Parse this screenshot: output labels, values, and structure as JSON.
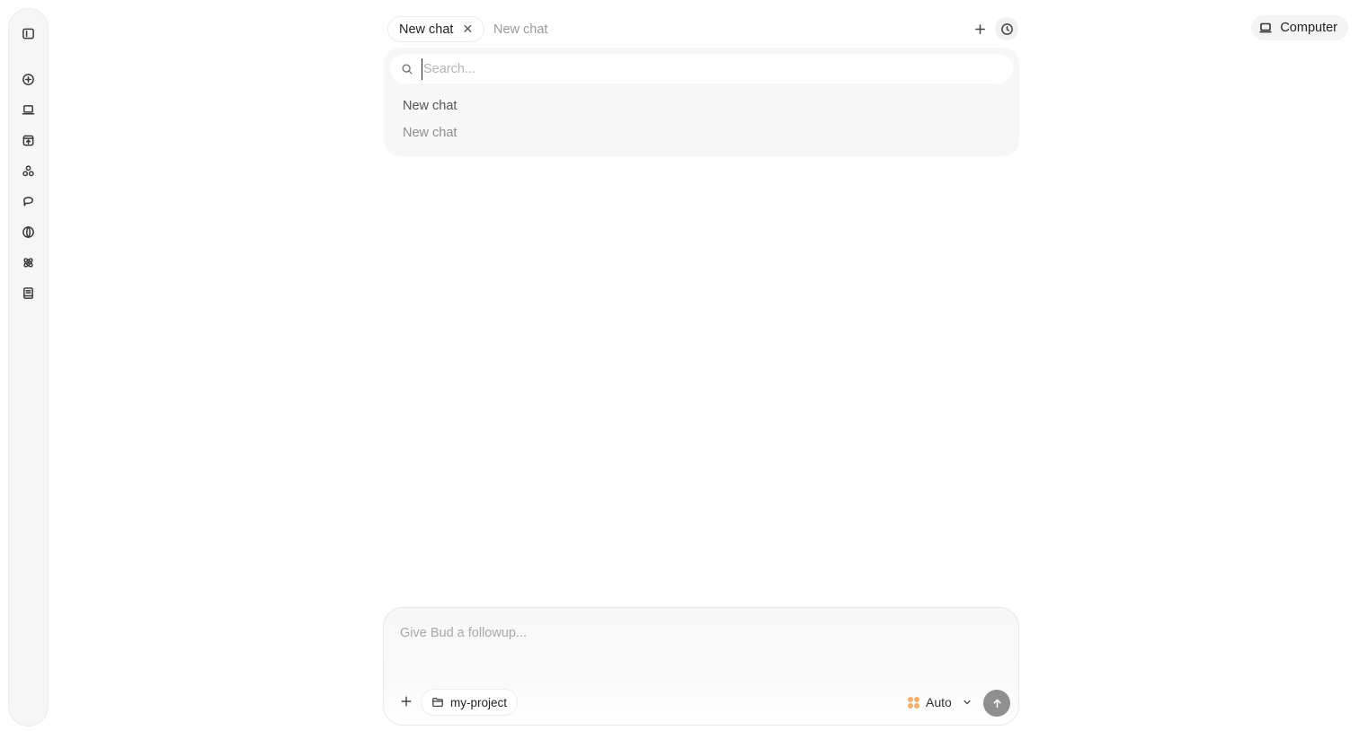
{
  "sidebar": {
    "items": [
      {
        "icon": "sidebar-toggle-icon"
      },
      {
        "icon": "new-chat-plus-circle-icon"
      },
      {
        "icon": "laptop-icon"
      },
      {
        "icon": "inbox-archive-icon"
      },
      {
        "icon": "shapes-icon"
      },
      {
        "icon": "chat-bubble-icon"
      },
      {
        "icon": "globe-icon"
      },
      {
        "icon": "atom-icon"
      },
      {
        "icon": "notebook-icon"
      }
    ]
  },
  "tabs": [
    {
      "label": "New chat",
      "active": true
    },
    {
      "label": "New chat",
      "active": false
    }
  ],
  "toolbar": {
    "computer_label": "Computer"
  },
  "history": {
    "search_placeholder": "Search...",
    "items": [
      "New chat",
      "New chat"
    ]
  },
  "composer": {
    "placeholder": "Give Bud a followup...",
    "project": "my-project",
    "model": "Auto"
  },
  "colors": {
    "accent_model": "#f2b06b",
    "send_button": "#8f8f8f"
  }
}
